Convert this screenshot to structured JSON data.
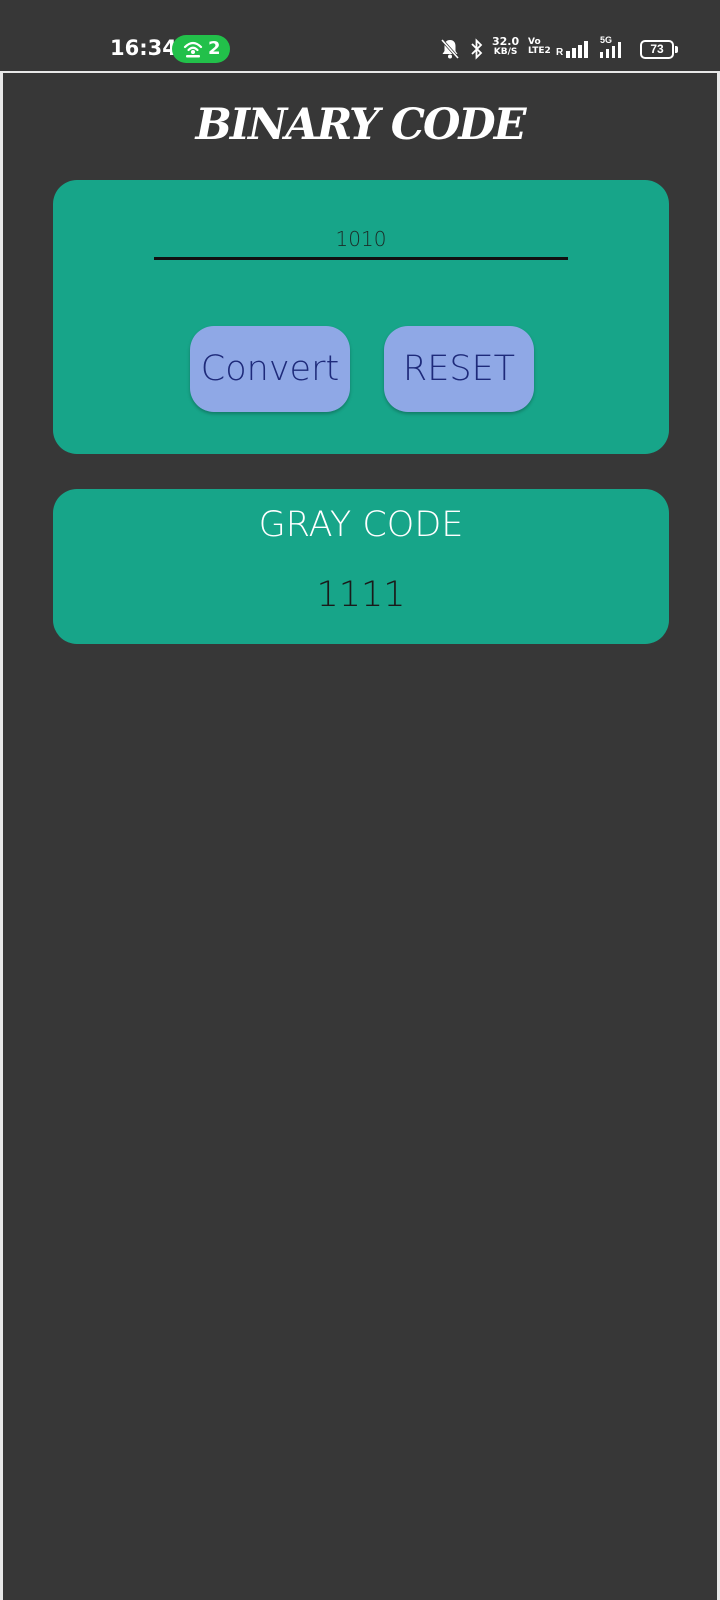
{
  "status_bar": {
    "time": "16:34",
    "hotspot_count": "2",
    "net_speed_value": "32.0",
    "net_speed_unit": "KB/S",
    "volte_top": "Vo",
    "volte_bottom": "LTE2",
    "roaming": "R",
    "network": "5G",
    "battery": "73",
    "icons": [
      "hotspot-icon",
      "mute-icon",
      "bluetooth-icon",
      "signal-icon",
      "battery-icon"
    ]
  },
  "app": {
    "title": "BINARY CODE"
  },
  "converter": {
    "input_value": "1010",
    "convert_label": "Convert",
    "reset_label": "RESET"
  },
  "result": {
    "label": "GRAY CODE",
    "value": "1111"
  },
  "colors": {
    "background": "#373737",
    "card": "#17a589",
    "button": "#8fa8e6",
    "button_text": "#1e2a7a",
    "hotspot": "#22c04a"
  }
}
